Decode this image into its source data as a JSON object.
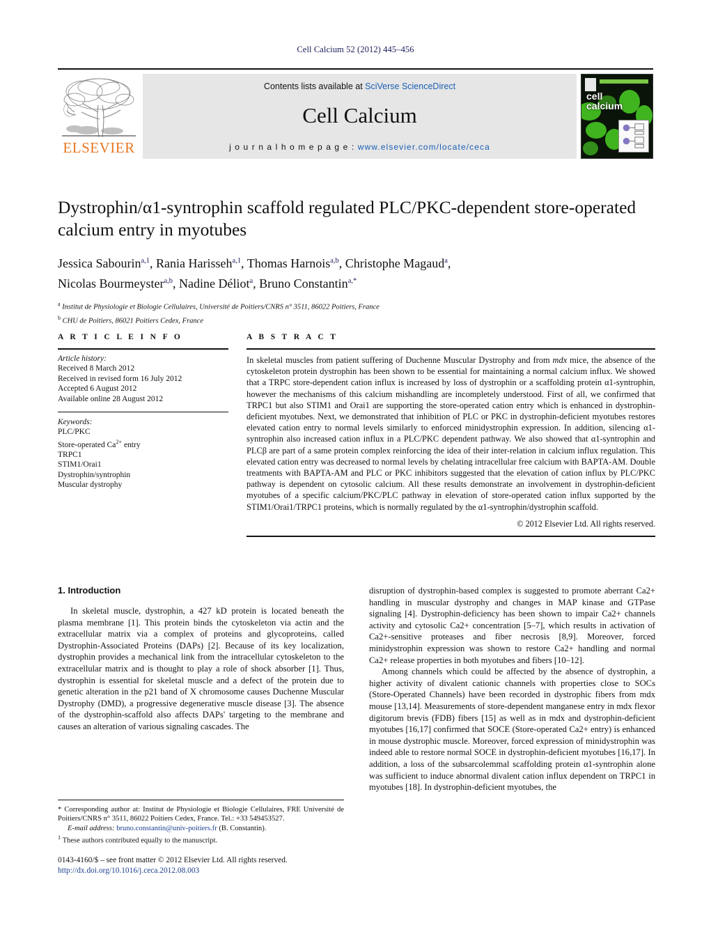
{
  "running_head": "Cell Calcium 52 (2012) 445–456",
  "masthead": {
    "contents_prefix": "Contents lists available at ",
    "contents_link": "SciVerse ScienceDirect",
    "journal_name": "Cell Calcium",
    "homepage_prefix": "j o u r n a l   h o m e p a g e :   ",
    "homepage_url": "www.elsevier.com/locate/ceca",
    "publisher": "ELSEVIER",
    "cover_title_line1": "cell",
    "cover_title_line2": "calcium"
  },
  "article": {
    "title": "Dystrophin/α1-syntrophin scaffold regulated PLC/PKC-dependent store-operated calcium entry in myotubes",
    "authors_line1": "Jessica Sabourin",
    "authors_line1_sup1": "a,1",
    "authors_line1_b": "Rania Harisseh",
    "authors_line1_sup2": "a,1",
    "authors_line1_c": "Thomas Harnois",
    "authors_line1_sup3": "a,b",
    "authors_line1_d": "Christophe Magaud",
    "authors_line1_sup4": "a",
    "authors_line2_a": "Nicolas Bourmeyster",
    "authors_line2_sup1": "a,b",
    "authors_line2_b": "Nadine Déliot",
    "authors_line2_sup2": "a",
    "authors_line2_c": "Bruno Constantin",
    "authors_line2_sup3": "a,*",
    "affiliation_a_sup": "a",
    "affiliation_a": "Institut de Physiologie et Biologie Cellulaires, Université de Poitiers/CNRS n° 3511, 86022 Poitiers, France",
    "affiliation_b_sup": "b",
    "affiliation_b": "CHU de Poitiers, 86021 Poitiers Cedex, France"
  },
  "article_info": {
    "heading": "A R T I C L E    I N F O",
    "history_label": "Article history:",
    "history": [
      "Received 8 March 2012",
      "Received in revised form 16 July 2012",
      "Accepted 6 August 2012",
      "Available online 28 August 2012"
    ],
    "keywords_label": "Keywords:",
    "keywords": [
      "PLC/PKC",
      "Store-operated Ca2+ entry",
      "TRPC1",
      "STIM1/Orai1",
      "Dystrophin/syntrophin",
      "Muscular dystrophy"
    ]
  },
  "abstract": {
    "heading": "A B S T R A C T",
    "paragraph_part1": "In skeletal muscles from patient suffering of Duchenne Muscular Dystrophy and from ",
    "mdx": "mdx",
    "paragraph_part2": " mice, the absence of the cytoskeleton protein dystrophin has been shown to be essential for maintaining a normal calcium influx. We showed that a TRPC store-dependent cation influx is increased by loss of dystrophin or a scaffolding protein α1-syntrophin, however the mechanisms of this calcium mishandling are incompletely understood. First of all, we confirmed that TRPC1 but also STIM1 and Orai1 are supporting the store-operated cation entry which is enhanced in dystrophin-deficient myotubes. Next, we demonstrated that inhibition of PLC or PKC in dystrophin-deficient myotubes restores elevated cation entry to normal levels similarly to enforced minidystrophin expression. In addition, silencing α1-syntrophin also increased cation influx in a PLC/PKC dependent pathway. We also showed that α1-syntrophin and PLCβ are part of a same protein complex reinforcing the idea of their inter-relation in calcium influx regulation. This elevated cation entry was decreased to normal levels by chelating intracellular free calcium with BAPTA-AM. Double treatments with BAPTA-AM and PLC or PKC inhibitors suggested that the elevation of cation influx by PLC/PKC pathway is dependent on cytosolic calcium. All these results demonstrate an involvement in dystrophin-deficient myotubes of a specific calcium/PKC/PLC pathway in elevation of store-operated cation influx supported by the STIM1/Orai1/TRPC1 proteins, which is normally regulated by the α1-syntrophin/dystrophin scaffold.",
    "copyright": "© 2012 Elsevier Ltd. All rights reserved."
  },
  "introduction": {
    "section_title": "1.  Introduction",
    "left_p1": "In skeletal muscle, dystrophin, a 427 kD protein is located beneath the plasma membrane [1]. This protein binds the cytoskeleton via actin and the extracellular matrix via a complex of proteins and glycoproteins, called Dystrophin-Associated Proteins (DAPs) [2]. Because of its key localization, dystrophin provides a mechanical link from the intracellular cytoskeleton to the extracellular matrix and is thought to play a role of shock absorber [1]. Thus, dystrophin is essential for skeletal muscle and a defect of the protein due to genetic alteration in the p21 band of X chromosome causes Duchenne Muscular Dystrophy (DMD), a progressive degenerative muscle disease [3]. The absence of the dystrophin-scaffold also affects DAPs' targeting to the membrane and causes an alteration of various signaling cascades. The",
    "right_p1": "disruption of dystrophin-based complex is suggested to promote aberrant Ca2+ handling in muscular dystrophy and changes in MAP kinase and GTPase signaling [4]. Dystrophin-deficiency has been shown to impair Ca2+ channels activity and cytosolic Ca2+ concentration [5–7], which results in activation of Ca2+-sensitive proteases and fiber necrosis [8,9]. Moreover, forced minidystrophin expression was shown to restore Ca2+ handling and normal Ca2+ release properties in both myotubes and fibers [10–12].",
    "right_p2": "Among channels which could be affected by the absence of dystrophin, a higher activity of divalent cationic channels with properties close to SOCs (Store-Operated Channels) have been recorded in dystrophic fibers from mdx mouse [13,14]. Measurements of store-dependent manganese entry in mdx flexor digitorum brevis (FDB) fibers [15] as well as in mdx and dystrophin-deficient myotubes [16,17] confirmed that SOCE (Store-operated Ca2+ entry) is enhanced in mouse dystrophic muscle. Moreover, forced expression of minidystrophin was indeed able to restore normal SOCE in dystrophin-deficient myotubes [16,17]. In addition, a loss of the subsarcolemmal scaffolding protein α1-syntrophin alone was sufficient to induce abnormal divalent cation influx dependent on TRPC1 in myotubes [18]. In dystrophin-deficient myotubes, the"
  },
  "footnotes": {
    "corresponding": "* Corresponding author at: Institut de Physiologie et Biologie Cellulaires, FRE Université de Poitiers/CNRS n° 3511, 86022 Poitiers Cedex, France. Tel.: +33 549453527.",
    "email_label": "E-mail address:",
    "email": "bruno.constantin@univ-poitiers.fr",
    "email_suffix": " (B. Constantin).",
    "equal_contrib_marker": "1",
    "equal_contrib": "These authors contributed equally to the manuscript."
  },
  "imprint": {
    "issn_line": "0143-4160/$ – see front matter © 2012 Elsevier Ltd. All rights reserved.",
    "doi": "http://dx.doi.org/10.1016/j.ceca.2012.08.003"
  },
  "colors": {
    "link": "#1a5fb4",
    "reference": "#1a3e8c",
    "elsevier_orange": "#E87722",
    "running_head": "#1b1b5c",
    "band_gray": "#e6e6e6"
  }
}
